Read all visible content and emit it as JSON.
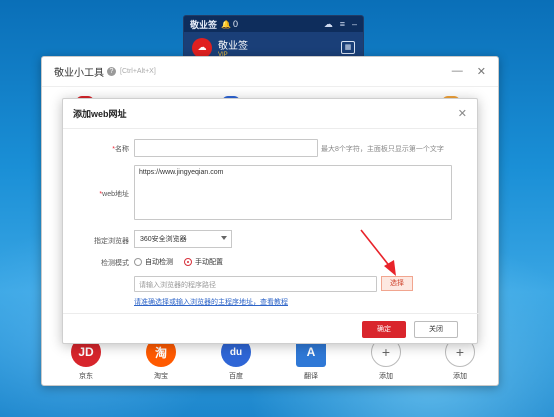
{
  "widget": {
    "title": "敬业签",
    "notify_count": "0",
    "account_name": "敬业签",
    "vip_badge": "VIP",
    "logo_glyph": "☁",
    "colors": {
      "bg": "#0e2d5c",
      "logo": "#e02020"
    }
  },
  "tool_window": {
    "title": "敬业小工具",
    "hotkey": "[Ctrl+Alt+X]",
    "bottom_items": [
      {
        "label": "京东",
        "glyph": "JD",
        "color": "#d7252c"
      },
      {
        "label": "淘宝",
        "glyph": "淘",
        "color": "#ff5a00"
      },
      {
        "label": "百度",
        "glyph": "du",
        "color": "#2f66d6"
      },
      {
        "label": "翻译",
        "glyph": "A",
        "color": "#2f78d6"
      },
      {
        "label": "添加",
        "glyph": "+",
        "color": "#ffffff"
      },
      {
        "label": "添加",
        "glyph": "+",
        "color": "#ffffff"
      }
    ]
  },
  "dialog": {
    "title": "添加web网址",
    "name_label": "名称",
    "name_hint": "最大8个字符，主面板只显示第一个文字",
    "name_value": "",
    "url_label": "web地址",
    "url_value": "https://www.jingyeqian.com",
    "browser_label": "指定浏览器",
    "browser_value": "360安全浏览器",
    "mode_label": "检测模式",
    "mode_auto": "自动检测",
    "mode_manual": "手动配置",
    "mode_selected": "手动配置",
    "path_placeholder": "请输入浏览器的程序路径",
    "select_button": "选择",
    "help_link": "请准确选择或输入浏览器的主程序地址，查看教程",
    "confirm_button": "确定",
    "close_button": "关闭",
    "accent_color": "#d9252c"
  },
  "annotation": {
    "arrow_color": "#e8232a"
  }
}
